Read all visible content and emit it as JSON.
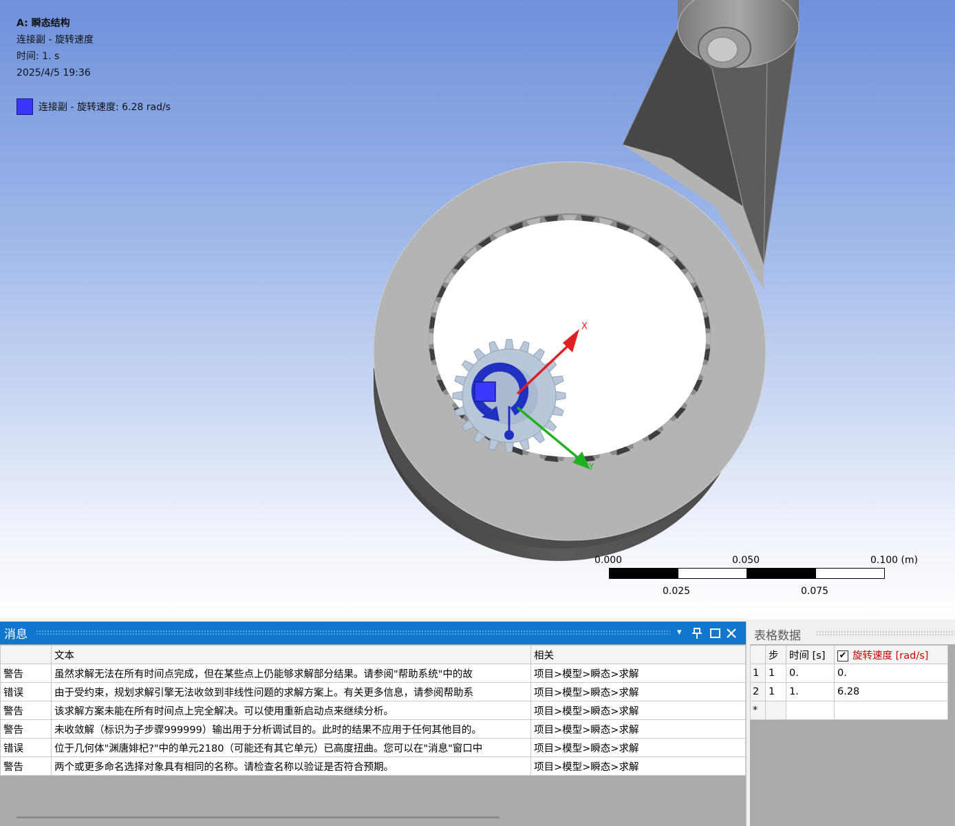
{
  "viewport": {
    "info": {
      "title": "A: 瞬态结构",
      "subtitle": "连接副 - 旋转速度",
      "time": "时间: 1. s",
      "date": "2025/4/5 19:36"
    },
    "legend": {
      "label": "连接副 - 旋转速度: 6.28 rad/s",
      "color": "#3737ff"
    },
    "triad": {
      "x_label": "X",
      "y_label": "Y",
      "x_color": "#e02020",
      "y_color": "#20b020"
    },
    "scale": {
      "top_labels": [
        "0.000",
        "0.050",
        "0.100 (m)"
      ],
      "bottom_labels": [
        "0.025",
        "0.075"
      ]
    }
  },
  "messages": {
    "title": "消息",
    "controls": {
      "dropdown": "▾",
      "pin": "📌",
      "maximize": "☐",
      "close": "✕"
    },
    "headers": [
      "",
      "文本",
      "相关"
    ],
    "rows": [
      [
        "警告",
        "虽然求解无法在所有时间点完成，但在某些点上仍能够求解部分结果。请参阅\"帮助系统\"中的故",
        "项目>模型>瞬态>求解"
      ],
      [
        "错误",
        "由于受约束，规划求解引擎无法收敛到非线性问题的求解方案上。有关更多信息，请参阅帮助系",
        "项目>模型>瞬态>求解"
      ],
      [
        "警告",
        "该求解方案未能在所有时间点上完全解决。可以使用重新启动点来继续分析。",
        "项目>模型>瞬态>求解"
      ],
      [
        "警告",
        "未收敛解（标识为子步骤999999）输出用于分析调试目的。此时的结果不应用于任何其他目的。",
        "项目>模型>瞬态>求解"
      ],
      [
        "错误",
        "位于几何体\"渊唐婔杞?\"中的单元2180（可能还有其它单元）已高度扭曲。您可以在\"消息\"窗口中",
        "项目>模型>瞬态>求解"
      ],
      [
        "警告",
        "两个或更多命名选择对象具有相同的名称。请检查名称以验证是否符合预期。",
        "项目>模型>瞬态>求解"
      ]
    ]
  },
  "tabular": {
    "title": "表格数据",
    "headers": {
      "step": "步",
      "time": "时间 [s]",
      "value": "旋转速度 [rad/s]"
    },
    "value_header_color": "#cc0000",
    "value_checked": true,
    "rows": [
      {
        "index": "1",
        "step": "1",
        "time": "0.",
        "value": "0."
      },
      {
        "index": "2",
        "step": "1",
        "time": "1.",
        "value": "6.28"
      }
    ],
    "new_row_marker": "*"
  }
}
